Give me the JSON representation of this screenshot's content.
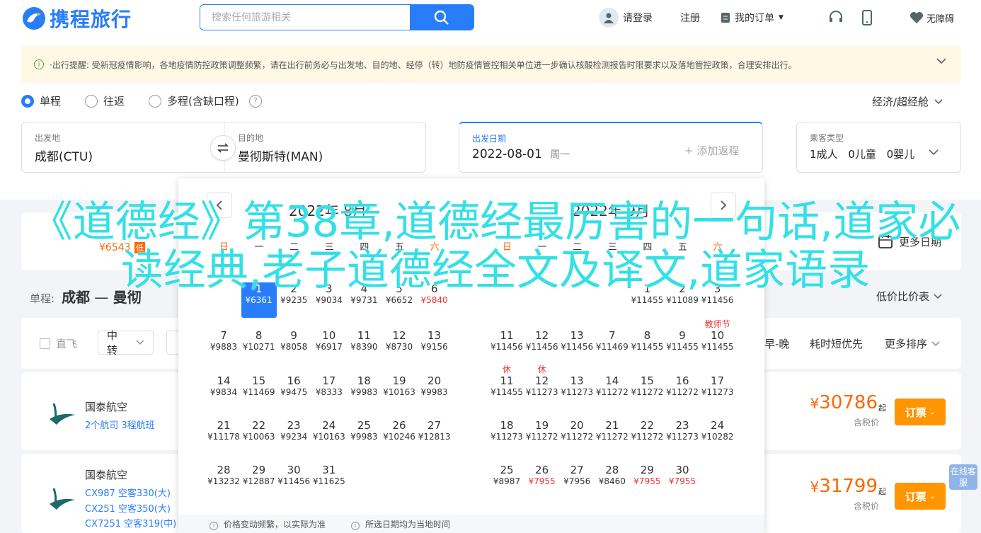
{
  "header": {
    "logo_text": "携程旅行",
    "search_placeholder": "搜索任何旅游相关",
    "login": "请登录",
    "register": "注册",
    "my_orders": "我的订单",
    "accessibility": "无障碍"
  },
  "notice": {
    "text": "·出行提醒: 受新冠疫情影响，各地疫情防控政策调整频繁，请在出行前务必与出发地、目的地、经停（转）地防疫情管控相关单位进一步确认核酸检测报告时限要求以及落地管控政策，合理安排出行。"
  },
  "trip_type": {
    "options": [
      "单程",
      "往返",
      "多程(含缺口程)"
    ],
    "cabin": "经济/超经舱"
  },
  "search_fields": {
    "from_label": "出发地",
    "from_value": "成都(CTU)",
    "to_label": "目的地",
    "to_value": "曼彻斯特(MAN)",
    "date_label": "出发日期",
    "date_value": "2022-08-01",
    "weekday": "周一",
    "add_return": "+ 添加返程",
    "pax_label": "乘客类型",
    "pax_adult": "1成人",
    "pax_child": "0儿童",
    "pax_infant": "0婴儿"
  },
  "date_strip": {
    "price": "¥6543",
    "badge": "低",
    "more_dates": "更多日期"
  },
  "route": {
    "prefix": "单程:",
    "from": "成都",
    "sep": "—",
    "to": "曼彻",
    "price_sort": "低价比价表"
  },
  "filters": {
    "direct": "直飞",
    "transfer": "中转",
    "early_late": "早-晚",
    "shortest": "耗时短优先",
    "more_sort": "更多排序"
  },
  "flights": [
    {
      "airline": "国泰航空",
      "line1": "2个航司  3程航班",
      "price": "30786",
      "qi": "起",
      "tax": "含税价",
      "book": "订票"
    },
    {
      "airline": "国泰航空",
      "line1": "CX987 空客330(大)",
      "line2": "CX251 空客350(大)",
      "line3": "CX7251 空客319(中)",
      "price": "31799",
      "qi": "起",
      "tax": "含税价",
      "book": "订票"
    }
  ],
  "calendar": {
    "month_left": "2022年 8月",
    "month_right": "2022年 9月",
    "weekdays": [
      "日",
      "一",
      "二",
      "三",
      "四",
      "五",
      "六"
    ],
    "aug": [
      {
        "d": "1",
        "p": "¥6361",
        "sel": true
      },
      {
        "d": "2",
        "p": "¥9235"
      },
      {
        "d": "3",
        "p": "¥9034"
      },
      {
        "d": "4",
        "p": "¥9731"
      },
      {
        "d": "5",
        "p": "¥6652"
      },
      {
        "d": "6",
        "p": "¥5840",
        "red": true
      },
      {
        "d": "7",
        "p": "¥9883"
      },
      {
        "d": "8",
        "p": "¥10271"
      },
      {
        "d": "9",
        "p": "¥8058"
      },
      {
        "d": "10",
        "p": "¥6917"
      },
      {
        "d": "11",
        "p": "¥8390"
      },
      {
        "d": "12",
        "p": "¥8730"
      },
      {
        "d": "13",
        "p": "¥9156"
      },
      {
        "d": "14",
        "p": "¥9834"
      },
      {
        "d": "15",
        "p": "¥11469"
      },
      {
        "d": "16",
        "p": "¥9475"
      },
      {
        "d": "17",
        "p": "¥8333"
      },
      {
        "d": "18",
        "p": "¥9983"
      },
      {
        "d": "19",
        "p": "¥10163"
      },
      {
        "d": "20",
        "p": "¥9983"
      },
      {
        "d": "21",
        "p": "¥11178"
      },
      {
        "d": "22",
        "p": "¥10063"
      },
      {
        "d": "23",
        "p": "¥9234"
      },
      {
        "d": "24",
        "p": "¥10163"
      },
      {
        "d": "25",
        "p": "¥9983"
      },
      {
        "d": "26",
        "p": "¥10246"
      },
      {
        "d": "27",
        "p": "¥12813"
      },
      {
        "d": "28",
        "p": "¥13232"
      },
      {
        "d": "29",
        "p": "¥12887"
      },
      {
        "d": "30",
        "p": "¥11456"
      },
      {
        "d": "31",
        "p": "¥11625"
      }
    ],
    "sep": [
      {
        "d": "1",
        "p": "¥11455"
      },
      {
        "d": "2",
        "p": "¥11089"
      },
      {
        "d": "3",
        "p": "¥11456"
      },
      {
        "d": "7",
        "p": "¥11469"
      },
      {
        "d": "8",
        "p": "¥11455"
      },
      {
        "d": "9",
        "p": "¥11455"
      },
      {
        "d": "10",
        "p": "¥11455",
        "tag": "教师节"
      },
      {
        "d": "11",
        "p": "¥11456"
      },
      {
        "d": "12",
        "p": "¥11456"
      },
      {
        "d": "13",
        "p": "¥11456"
      },
      {
        "d": "11",
        "p": "¥11455",
        "tag": "休"
      },
      {
        "d": "12",
        "p": "¥11273",
        "tag": "休"
      },
      {
        "d": "13",
        "p": "¥11273"
      },
      {
        "d": "14",
        "p": "¥11272"
      },
      {
        "d": "15",
        "p": "¥11272"
      },
      {
        "d": "16",
        "p": "¥11272"
      },
      {
        "d": "17",
        "p": "¥11273"
      },
      {
        "d": "18",
        "p": "¥11273"
      },
      {
        "d": "19",
        "p": "¥11272"
      },
      {
        "d": "20",
        "p": "¥11272"
      },
      {
        "d": "21",
        "p": "¥11272"
      },
      {
        "d": "22",
        "p": "¥11272"
      },
      {
        "d": "23",
        "p": "¥11273"
      },
      {
        "d": "24",
        "p": "¥10282"
      },
      {
        "d": "25",
        "p": "¥8987"
      },
      {
        "d": "26",
        "p": "¥7955",
        "red": true
      },
      {
        "d": "27",
        "p": "¥7956"
      },
      {
        "d": "28",
        "p": "¥8460"
      },
      {
        "d": "29",
        "p": "¥7955",
        "red": true
      },
      {
        "d": "30",
        "p": "¥7955",
        "red": true
      }
    ],
    "foot1": "价格变动频繁，以实际为准",
    "foot2": "所选日期均为当地时间"
  },
  "overlay_text": "《道德经》第38章,道德经最厉害的一句话,道家必读经典,老子道德经全文及译文,道家语录",
  "online_service": "在线客服",
  "colors": {
    "brand": "#287dfa",
    "orange": "#ff9500",
    "price": "#ff6600",
    "overlay": "#33e0e6"
  }
}
